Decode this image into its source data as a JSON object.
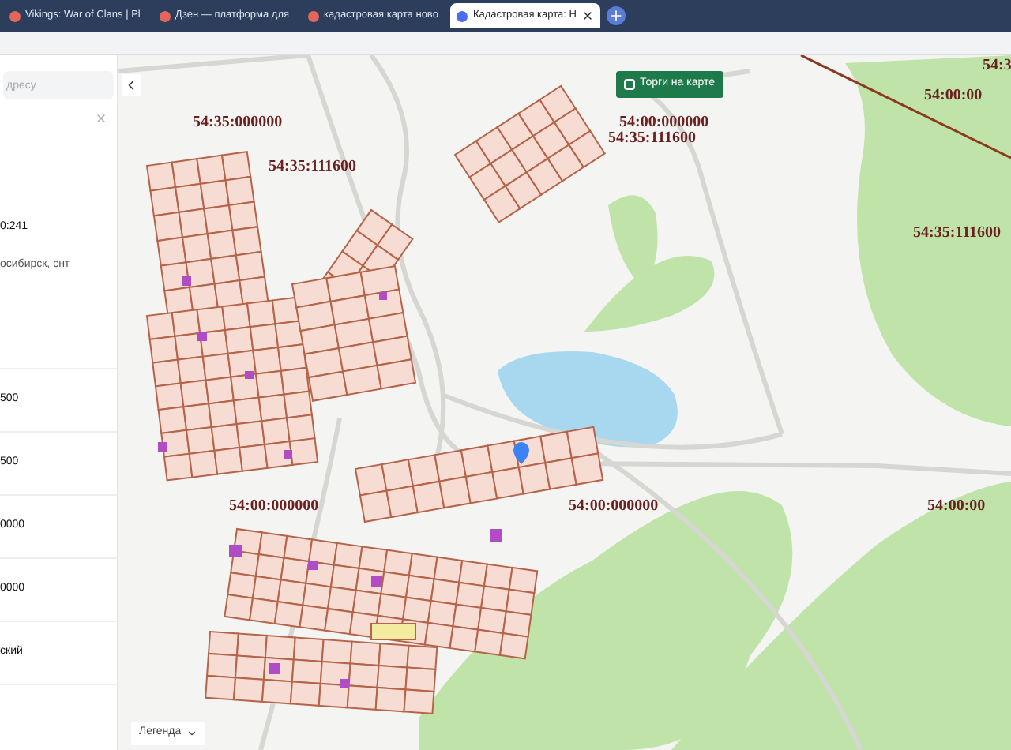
{
  "browser_tabs": [
    {
      "title": "Vikings: War of Clans | Pl",
      "selected": false
    },
    {
      "title": "Дзен — платформа для",
      "selected": false
    },
    {
      "title": "кадастровая карта ново",
      "selected": false
    },
    {
      "title": "Кадастровая карта: Н",
      "selected": true
    }
  ],
  "sidebar": {
    "search": {
      "placeholder": "дресу"
    },
    "items": [
      {
        "lines": [
          "0:241",
          "осибирск, снт"
        ]
      },
      {
        "lines": [
          "500"
        ]
      },
      {
        "lines": [
          "500"
        ]
      },
      {
        "lines": [
          "0000"
        ]
      },
      {
        "lines": [
          "0000"
        ]
      },
      {
        "lines": [
          "ский"
        ]
      }
    ]
  },
  "map": {
    "trade_toggle": {
      "label": "Торги на карте",
      "checked": false
    },
    "legend": {
      "label": "Легенда"
    },
    "cadastral_labels": [
      "54:35:000000",
      "54:35:111600",
      "54:00:000000",
      "54:35:111600",
      "54:3",
      "54:00:00",
      "54:35:111600",
      "54:00:000000",
      "54:00:000000",
      "54:00:00"
    ]
  }
}
